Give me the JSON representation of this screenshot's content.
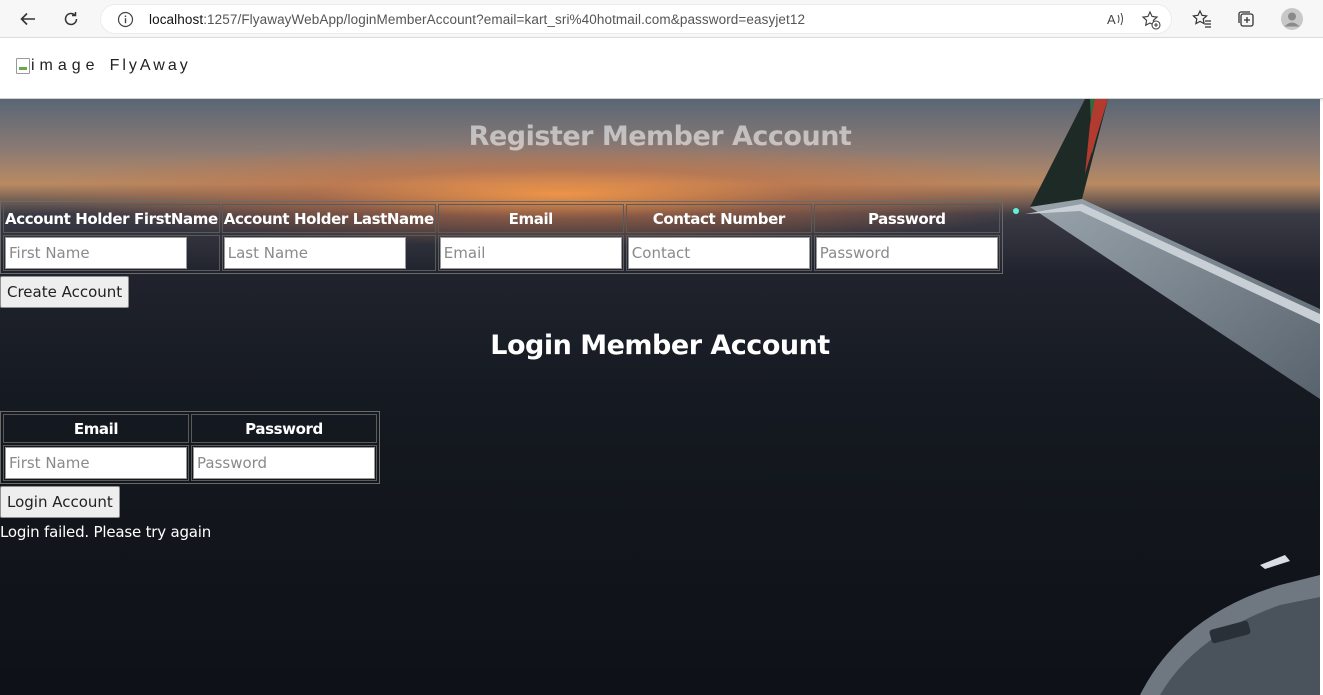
{
  "browser": {
    "url_host": "localhost",
    "url_rest": ":1257/FlyawayWebApp/loginMemberAccount?email=kart_sri%40hotmail.com&password=easyjet12",
    "icons": [
      "back-arrow-icon",
      "refresh-icon",
      "info-icon",
      "read-aloud-icon",
      "add-favorite-icon",
      "favorites-icon",
      "collections-icon",
      "profile-icon"
    ]
  },
  "header": {
    "logo_alt": "image",
    "brand": "FlyAway"
  },
  "register": {
    "title": "Register Member Account",
    "columns": [
      "Account Holder FirstName",
      "Account Holder LastName",
      "Email",
      "Contact Number",
      "Password"
    ],
    "placeholders": [
      "First Name",
      "Last Name",
      "Email",
      "Contact",
      "Password"
    ],
    "button": "Create Account"
  },
  "login": {
    "title": "Login Member Account",
    "columns": [
      "Email",
      "Password"
    ],
    "placeholders": [
      "First Name",
      "Password"
    ],
    "button": "Login Account",
    "message": "Login failed. Please try again"
  },
  "colors": {
    "heading": "#ffffff",
    "button_bg": "#eeeeee"
  }
}
